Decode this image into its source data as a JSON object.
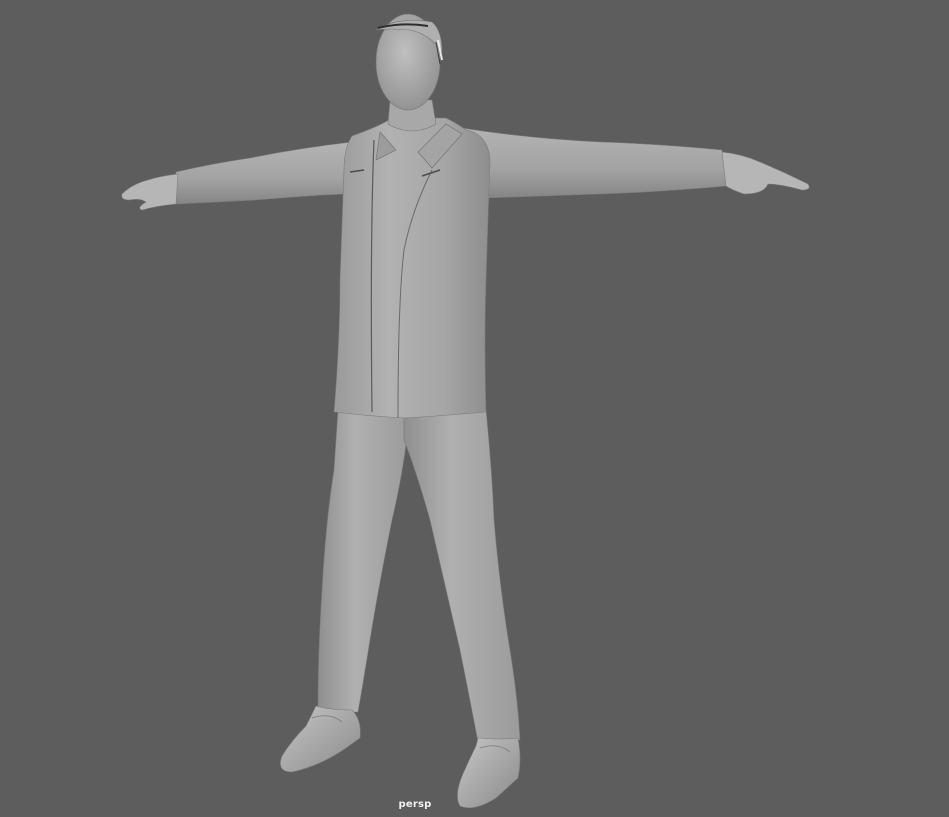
{
  "viewport": {
    "camera_label": "persp",
    "background_color": "#5d5d5d",
    "shading": "smooth-shaded",
    "model": {
      "description_icon": "character-model",
      "base_color": "#a9a9a9",
      "shadow_color": "#8a8a8a",
      "highlight_color": "#c4c4c4"
    }
  }
}
